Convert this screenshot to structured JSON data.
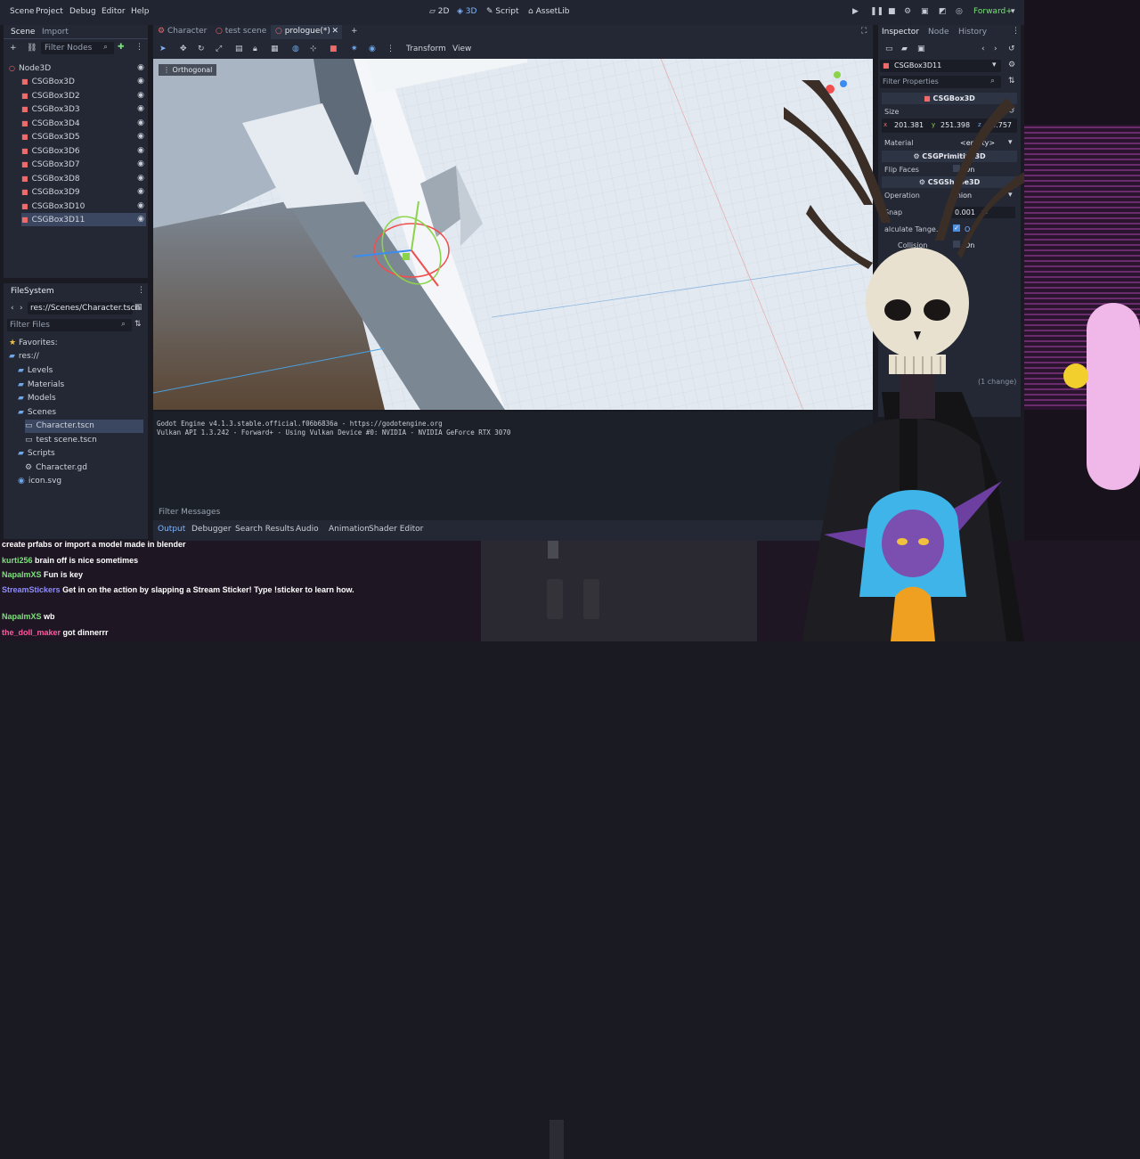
{
  "menu": [
    "Scene",
    "Project",
    "Debug",
    "Editor",
    "Help"
  ],
  "workspaces": [
    "2D",
    "3D",
    "Script",
    "AssetLib"
  ],
  "renderer": "Forward+",
  "scene_dock": {
    "tabs": [
      "Scene",
      "Import"
    ],
    "filter_placeholder": "Filter Nodes",
    "root": "Node3D",
    "nodes": [
      "CSGBox3D",
      "CSGBox3D2",
      "CSGBox3D3",
      "CSGBox3D4",
      "CSGBox3D5",
      "CSGBox3D6",
      "CSGBox3D7",
      "CSGBox3D8",
      "CSGBox3D9",
      "CSGBox3D10",
      "CSGBox3D11"
    ],
    "selected_index": 10
  },
  "filesystem": {
    "title": "FileSystem",
    "path": "res://Scenes/Character.tscn",
    "filter_placeholder": "Filter Files",
    "favorites": "Favorites:",
    "root": "res://",
    "items": [
      {
        "label": "Levels",
        "type": "folder"
      },
      {
        "label": "Materials",
        "type": "folder"
      },
      {
        "label": "Models",
        "type": "folder"
      },
      {
        "label": "Scenes",
        "type": "folder"
      },
      {
        "label": "Character.tscn",
        "type": "scene",
        "selected": true
      },
      {
        "label": "test scene.tscn",
        "type": "scene"
      },
      {
        "label": "Scripts",
        "type": "folder"
      },
      {
        "label": "Character.gd",
        "type": "script"
      },
      {
        "label": "icon.svg",
        "type": "image"
      }
    ]
  },
  "editor_tabs": [
    "Character",
    "test scene",
    "prologue(*)"
  ],
  "viewport": {
    "toolbar_menus": [
      "Transform",
      "View"
    ],
    "view_label": "Orthogonal"
  },
  "output": {
    "lines": [
      "Godot Engine v4.1.3.stable.official.f06b6836a - https://godotengine.org",
      "Vulkan API 1.3.242 - Forward+ - Using Vulkan Device #0: NVIDIA - NVIDIA GeForce RTX 3070"
    ],
    "filter_placeholder": "Filter Messages",
    "bottom_tabs": [
      "Output",
      "Debugger",
      "Search Results",
      "Audio",
      "Animation",
      "Shader Editor"
    ]
  },
  "inspector": {
    "tabs": [
      "Inspector",
      "Node",
      "History"
    ],
    "object": "CSGBox3D11",
    "filter_placeholder": "Filter Properties",
    "class": "CSGBox3D",
    "size_label": "Size",
    "size": {
      "x": "201.381",
      "y": "251.398",
      "z": "60.757"
    },
    "material_label": "Material",
    "material_value": "<empty>",
    "primitive_section": "CSGPrimitive3D",
    "flip_faces_label": "Flip Faces",
    "flip_faces_value": "On",
    "shape_section": "CSGShape3D",
    "operation_label": "Operation",
    "operation_value": "Union",
    "snap_label": "Snap",
    "snap_value": "0.001",
    "snap_unit": "m",
    "calc_tangents_label": "alculate Tange...",
    "calc_tangents_value": "On",
    "collision_label": "Collision",
    "collision_value": "On",
    "changes": "(1 change)"
  },
  "chat": [
    {
      "user": "",
      "text": "create prfabs or import a model made in blender"
    },
    {
      "user": "kurti256",
      "text": "brain off is nice sometimes"
    },
    {
      "user": "NapalmXS",
      "text": "Fun is key"
    },
    {
      "user": "StreamStickers",
      "text": "Get in on the action by slapping a Stream Sticker! Type !sticker to learn how."
    },
    {
      "user": "NapalmXS",
      "text": "wb"
    },
    {
      "user": "the_doll_maker",
      "text": "got dinnerrr"
    }
  ],
  "colors": {
    "accent": "#7fb6ff",
    "panel": "#232834",
    "bg": "#1c2029",
    "selection": "#3b4761"
  }
}
